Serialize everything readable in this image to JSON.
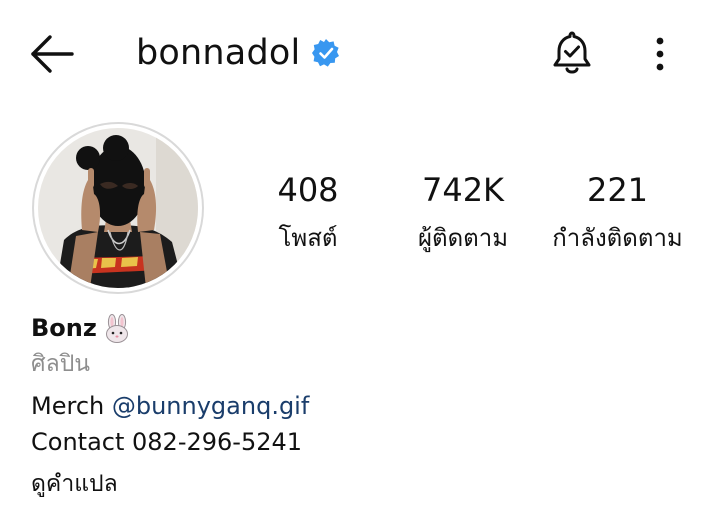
{
  "header": {
    "username": "bonnadol",
    "verified": true,
    "back_icon": "arrow-left-icon",
    "notify_icon": "bell-check-icon",
    "more_icon": "more-vertical-icon"
  },
  "stats": {
    "posts": {
      "value": "408",
      "label": "โพสต์"
    },
    "followers": {
      "value": "742K",
      "label": "ผู้ติดตาม"
    },
    "following": {
      "value": "221",
      "label": "กำลังติดตาม"
    }
  },
  "profile": {
    "display_name": "Bonz",
    "emoji_icon": "rabbit-face-icon",
    "category": "ศิลปิน",
    "bio": {
      "line1_prefix": "Merch ",
      "line1_mention": "@bunnyganq.gif",
      "line2": "Contact 082-296-5241"
    },
    "translate_label": "ดูคำแปล"
  },
  "colors": {
    "verified_badge": "#3897f0",
    "mention": "#1a3d6b",
    "secondary_text": "#8e8e8e",
    "avatar_ring": "#d9d9d9"
  }
}
